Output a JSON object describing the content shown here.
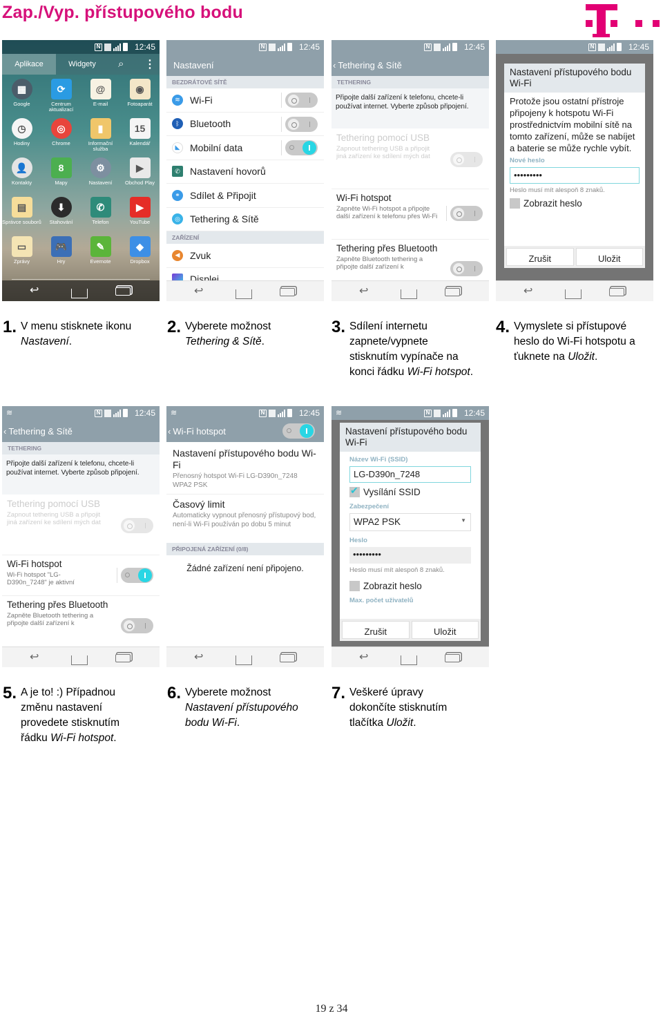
{
  "page": {
    "title": "Zap./Vyp. přístupového bodu",
    "page_number": "19 z 34",
    "brand_color": "#e20074",
    "title_color": "#d6117a"
  },
  "status_bar": {
    "time": "12:45",
    "nfc": "N"
  },
  "screen1": {
    "tabs": {
      "apps": "Aplikace",
      "widgets": "Widgety"
    },
    "apps": [
      {
        "label": "Google",
        "icon": "google-folder-icon",
        "bg": "#4b5d6a",
        "glyph": "▦"
      },
      {
        "label": "Centrum aktualizací",
        "icon": "update-center-icon",
        "bg": "#2a9be3",
        "glyph": "⟳"
      },
      {
        "label": "E-mail",
        "icon": "email-icon",
        "bg": "#f7f2e3",
        "glyph": "@"
      },
      {
        "label": "Fotoaparát",
        "icon": "camera-icon",
        "bg": "#f3e6c8",
        "glyph": "◉"
      },
      {
        "label": "Hodiny",
        "icon": "clock-icon",
        "bg": "#f5f5f5",
        "glyph": "◷"
      },
      {
        "label": "Chrome",
        "icon": "chrome-icon",
        "bg": "#e8453c",
        "glyph": "◎"
      },
      {
        "label": "Informační služba",
        "icon": "news-icon",
        "bg": "#f0c66a",
        "glyph": "▮"
      },
      {
        "label": "Kalendář",
        "icon": "calendar-icon",
        "bg": "#f5f5f5",
        "glyph": "15"
      },
      {
        "label": "Kontakty",
        "icon": "contacts-icon",
        "bg": "#e4e4e4",
        "glyph": "👤"
      },
      {
        "label": "Mapy",
        "icon": "maps-icon",
        "bg": "#4caf50",
        "glyph": "8"
      },
      {
        "label": "Nastavení",
        "icon": "settings-gear-icon",
        "bg": "#7d8fa0",
        "glyph": "⚙"
      },
      {
        "label": "Obchod Play",
        "icon": "play-store-icon",
        "bg": "#e9e9e9",
        "glyph": "▶"
      },
      {
        "label": "Správce souborů",
        "icon": "file-manager-icon",
        "bg": "#f6dd9a",
        "glyph": "▤"
      },
      {
        "label": "Stahování",
        "icon": "download-icon",
        "bg": "#2b2b2b",
        "glyph": "⬇"
      },
      {
        "label": "Telefon",
        "icon": "phone-icon",
        "bg": "#2e8b7a",
        "glyph": "✆"
      },
      {
        "label": "YouTube",
        "icon": "youtube-icon",
        "bg": "#e52d27",
        "glyph": "▶"
      },
      {
        "label": "Zprávy",
        "icon": "messages-icon",
        "bg": "#f4e4b4",
        "glyph": "▭"
      },
      {
        "label": "Hry",
        "icon": "games-icon",
        "bg": "#3c6fb6",
        "glyph": "🎮"
      },
      {
        "label": "Evernote",
        "icon": "evernote-icon",
        "bg": "#5bb53a",
        "glyph": "✎"
      },
      {
        "label": "Dropbox",
        "icon": "dropbox-icon",
        "bg": "#3d8fe6",
        "glyph": "◆"
      }
    ]
  },
  "screen2": {
    "appbar_title": "Nastavení",
    "section_wireless": "BEZDRÁTOVÉ SÍTĚ",
    "section_device": "ZAŘÍZENÍ",
    "items": [
      {
        "label": "Wi-Fi",
        "toggle": "off"
      },
      {
        "label": "Bluetooth",
        "toggle": "off"
      },
      {
        "label": "Mobilní data",
        "toggle": "on"
      },
      {
        "label": "Nastavení hovorů"
      },
      {
        "label": "Sdílet & Připojit"
      },
      {
        "label": "Tethering & Sítě"
      }
    ],
    "device_items": [
      {
        "label": "Zvuk"
      },
      {
        "label": "Displej"
      }
    ]
  },
  "tethering": {
    "appbar_title": "Tethering & Sítě",
    "section": "TETHERING",
    "description": "Připojte další zařízení k telefonu, chcete-li používat internet. Vyberte způsob připojení.",
    "usb_title": "Tethering pomocí USB",
    "usb_sub": "Zapnout tethering USB a připojit jiná zařízení ke sdílení mých dat",
    "hotspot_title": "Wi-Fi hotspot",
    "hotspot_sub_off": "Zapněte Wi-Fi hotspot a připojte další zařízení k telefonu přes Wi-Fi",
    "hotspot_sub_on": "Wi-Fi hotspot \"LG-D390n_7248\" je aktivní",
    "bt_title": "Tethering přes Bluetooth",
    "bt_sub": "Zapněte Bluetooth tethering a připojte další zařízení k"
  },
  "screen4": {
    "dialog_title": "Nastavení přístupového bodu Wi-Fi",
    "message": "Protože jsou ostatní přístroje připojeny k hotspotu Wi-Fi prostřednictvím mobilní sítě na tomto zařízení, může se nabíjet a baterie se může rychle vybít.",
    "new_password_label": "Nové heslo",
    "password_value": "•••••••••",
    "hint": "Heslo musí mít alespoň 8 znaků.",
    "show_password": "Zobrazit heslo",
    "cancel": "Zrušit",
    "save": "Uložit"
  },
  "screen6": {
    "appbar_title": "Wi-Fi hotspot",
    "item1_title": "Nastavení přístupového bodu Wi-Fi",
    "item1_sub": "Přenosný hotspot Wi-Fi LG-D390n_7248 WPA2 PSK",
    "item2_title": "Časový limit",
    "item2_sub": "Automaticky vypnout přenosný přístupový bod, není-li Wi-Fi používán po dobu 5 minut",
    "section_connected": "PŘIPOJENÁ ZAŘÍZENÍ (0/8)",
    "empty": "Žádné zařízení není připojeno."
  },
  "screen7": {
    "dialog_title": "Nastavení přístupového bodu Wi-Fi",
    "ssid_label": "Název Wi-Fi (SSID)",
    "ssid_value": "LG-D390n_7248",
    "broadcast_ssid": "Vysílání SSID",
    "security_label": "Zabezpečení",
    "security_value": "WPA2 PSK",
    "password_label": "Heslo",
    "password_value": "•••••••••",
    "hint": "Heslo musí mít alespoň 8 znaků.",
    "show_password": "Zobrazit heslo",
    "max_users_label": "Max. počet uživatelů",
    "cancel": "Zrušit",
    "save": "Uložit"
  },
  "steps": [
    {
      "num": "1.",
      "text": "V menu stisknete ikonu ",
      "em": "Nastavení",
      "tail": "."
    },
    {
      "num": "2.",
      "text": "Vyberete možnost ",
      "em": "Tethering & Sítě",
      "tail": "."
    },
    {
      "num": "3.",
      "text": "Sdílení internetu zapnete/vypnete stisknutím vypínače na konci řádku ",
      "em": "Wi-Fi hotspot",
      "tail": "."
    },
    {
      "num": "4.",
      "text": "Vymyslete si přístupové heslo do Wi-Fi hotspotu a ťuknete na ",
      "em": "Uložit",
      "tail": "."
    },
    {
      "num": "5.",
      "text": "A je to! :) Případnou změnu nastavení provedete stisknutím řádku ",
      "em": "Wi-Fi hotspot",
      "tail": "."
    },
    {
      "num": "6.",
      "text": "Vyberete možnost ",
      "em": "Nastavení přístupového bodu Wi-Fi",
      "tail": "."
    },
    {
      "num": "7.",
      "text": "Veškeré úpravy dokončíte stisknutím tlačítka ",
      "em": "Uložit",
      "tail": "."
    }
  ]
}
